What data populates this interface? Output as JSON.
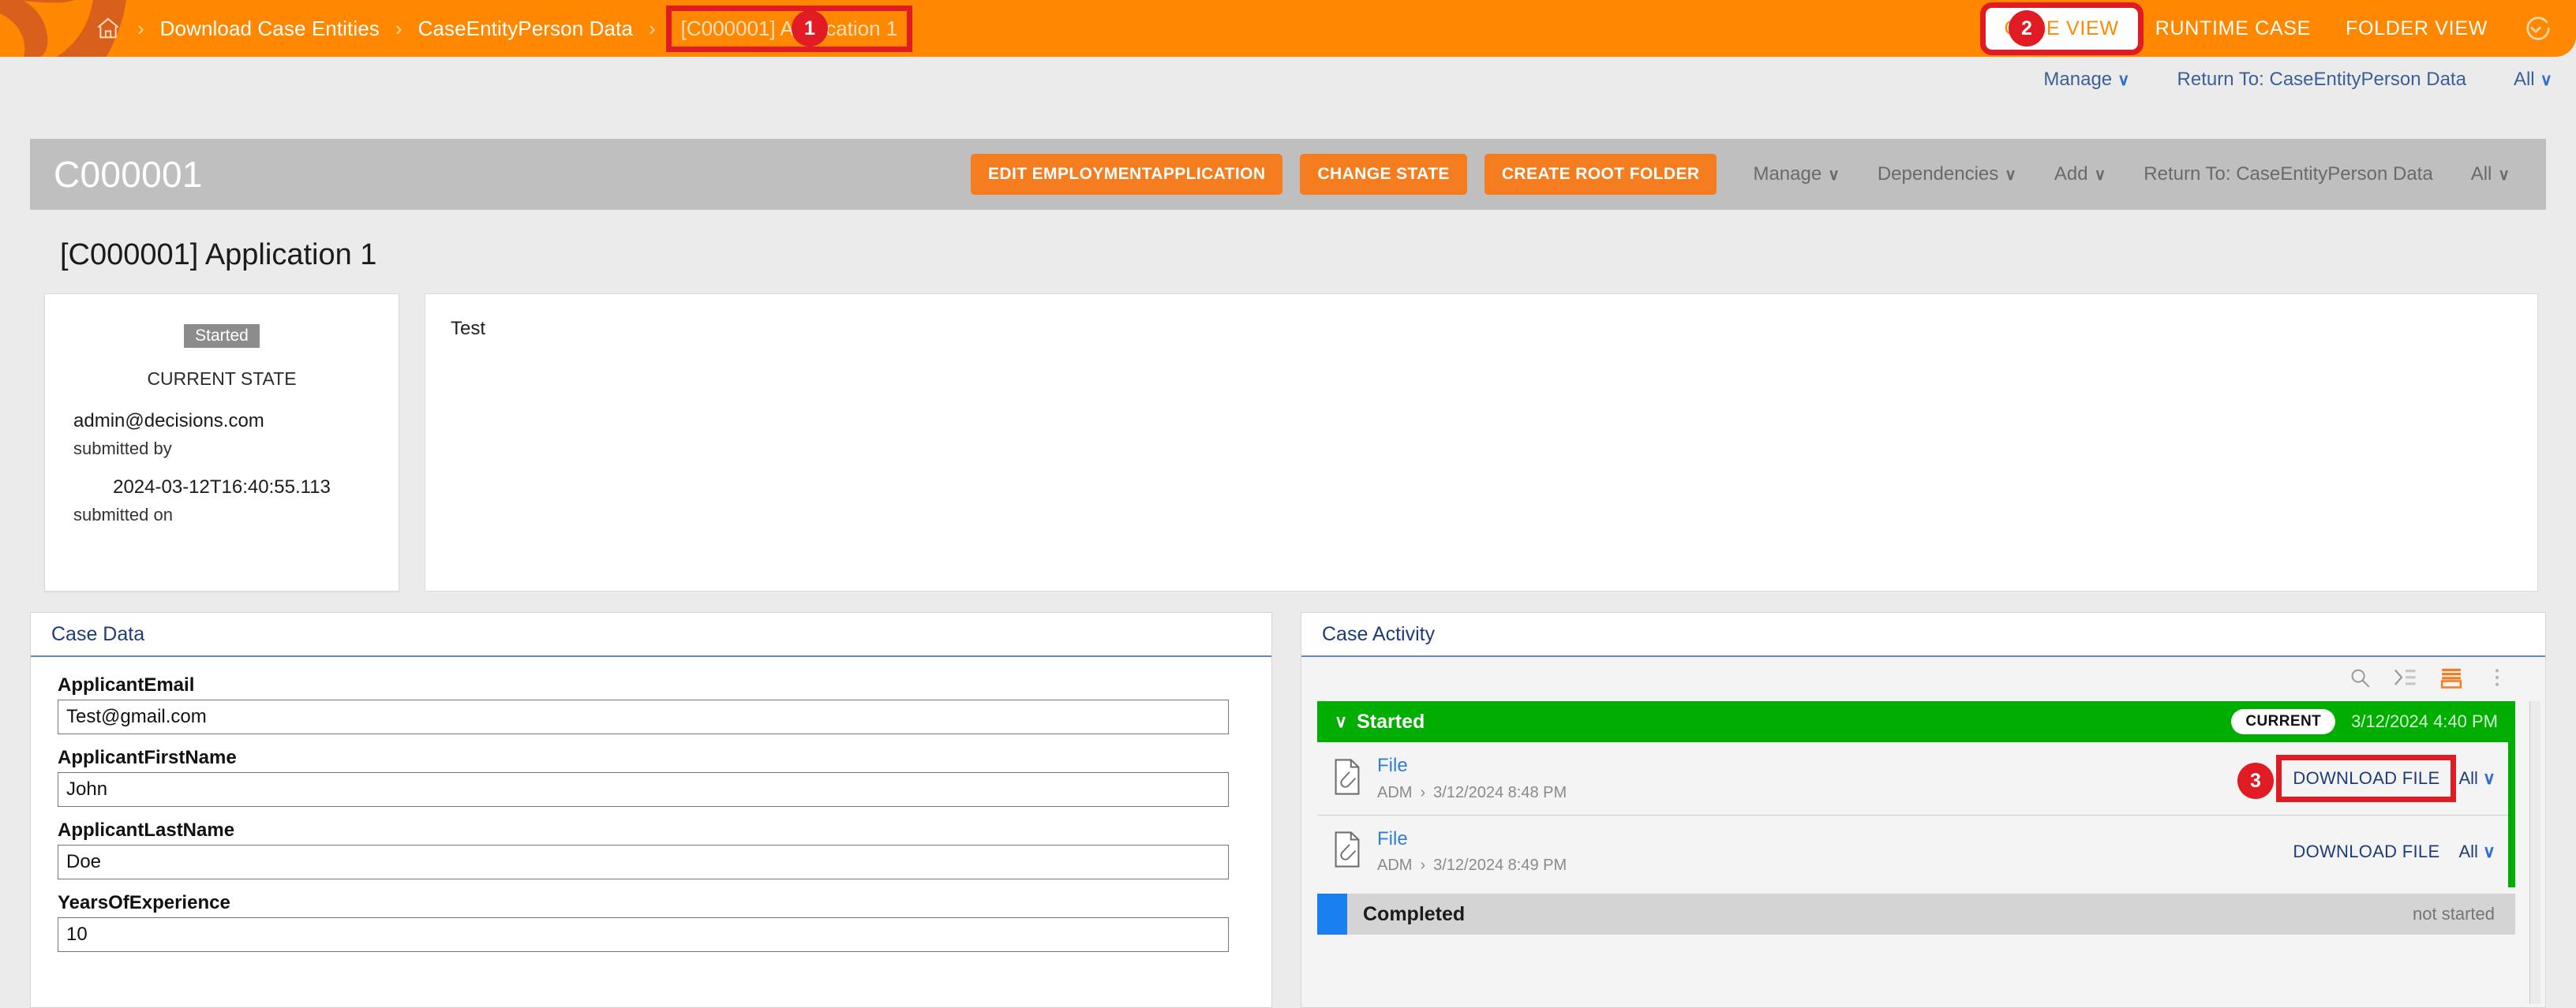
{
  "header": {
    "home_icon": "home-icon",
    "breadcrumbs": [
      {
        "label": "Download Case Entities",
        "current": false
      },
      {
        "label": "CaseEntityPerson Data",
        "current": false
      },
      {
        "label": "[C000001] Application 1",
        "current": true
      }
    ],
    "nav": [
      {
        "label": "CASE VIEW",
        "active": true
      },
      {
        "label": "RUNTIME CASE",
        "active": false
      },
      {
        "label": "FOLDER VIEW",
        "active": false
      }
    ],
    "refresh_icon": "refresh-icon",
    "accent_color": "#ff8800",
    "highlight_color": "#e01b24"
  },
  "subnav": {
    "items": [
      {
        "label": "Manage",
        "caret": "∨"
      },
      {
        "label": "Return To: CaseEntityPerson Data",
        "caret": ""
      },
      {
        "label": "All",
        "caret": "∨"
      }
    ]
  },
  "annotations": [
    {
      "num": "1"
    },
    {
      "num": "2"
    },
    {
      "num": "3"
    }
  ],
  "titlebar": {
    "case_id": "C000001",
    "buttons": [
      {
        "label": "EDIT EMPLOYMENTAPPLICATION"
      },
      {
        "label": "CHANGE STATE"
      },
      {
        "label": "CREATE ROOT FOLDER"
      }
    ],
    "links": [
      {
        "label": "Manage",
        "caret": "∨"
      },
      {
        "label": "Dependencies",
        "caret": "∨"
      },
      {
        "label": "Add",
        "caret": "∨"
      },
      {
        "label": "Return To: CaseEntityPerson Data",
        "caret": ""
      },
      {
        "label": "All",
        "caret": "∨"
      }
    ]
  },
  "page_title": "[C000001] Application 1",
  "status_card": {
    "state_pill": "Started",
    "state_caption": "CURRENT STATE",
    "submitted_by_value": "admin@decisions.com",
    "submitted_by_label": "submitted by",
    "submitted_on_value": "2024-03-12T16:40:55.113",
    "submitted_on_label": "submitted on"
  },
  "note_panel": {
    "text": "Test"
  },
  "case_data": {
    "title": "Case Data",
    "fields": [
      {
        "label": "ApplicantEmail",
        "value": "Test@gmail.com"
      },
      {
        "label": "ApplicantFirstName",
        "value": "John"
      },
      {
        "label": "ApplicantLastName",
        "value": "Doe"
      },
      {
        "label": "YearsOfExperience",
        "value": "10"
      }
    ]
  },
  "case_activity": {
    "title": "Case Activity",
    "toolbar_icons": [
      "search-icon",
      "collapse-list-icon",
      "list-view-icon",
      "more-vertical-icon"
    ],
    "started_group": {
      "chevron": "∨",
      "name": "Started",
      "badge": "CURRENT",
      "date": "3/12/2024 4:40 PM",
      "color": "#00ae00"
    },
    "rows": [
      {
        "icon": "file-attachment-icon",
        "title": "File",
        "user": "ADM",
        "sep": "›",
        "date": "3/12/2024 8:48 PM",
        "action": "DOWNLOAD FILE",
        "all": "All",
        "caret": "∨",
        "highlighted": true
      },
      {
        "icon": "file-attachment-icon",
        "title": "File",
        "user": "ADM",
        "sep": "›",
        "date": "3/12/2024 8:49 PM",
        "action": "DOWNLOAD FILE",
        "all": "All",
        "caret": "∨",
        "highlighted": false
      }
    ],
    "completed_group": {
      "name": "Completed",
      "status": "not started",
      "color": "#1a7ff0"
    }
  }
}
